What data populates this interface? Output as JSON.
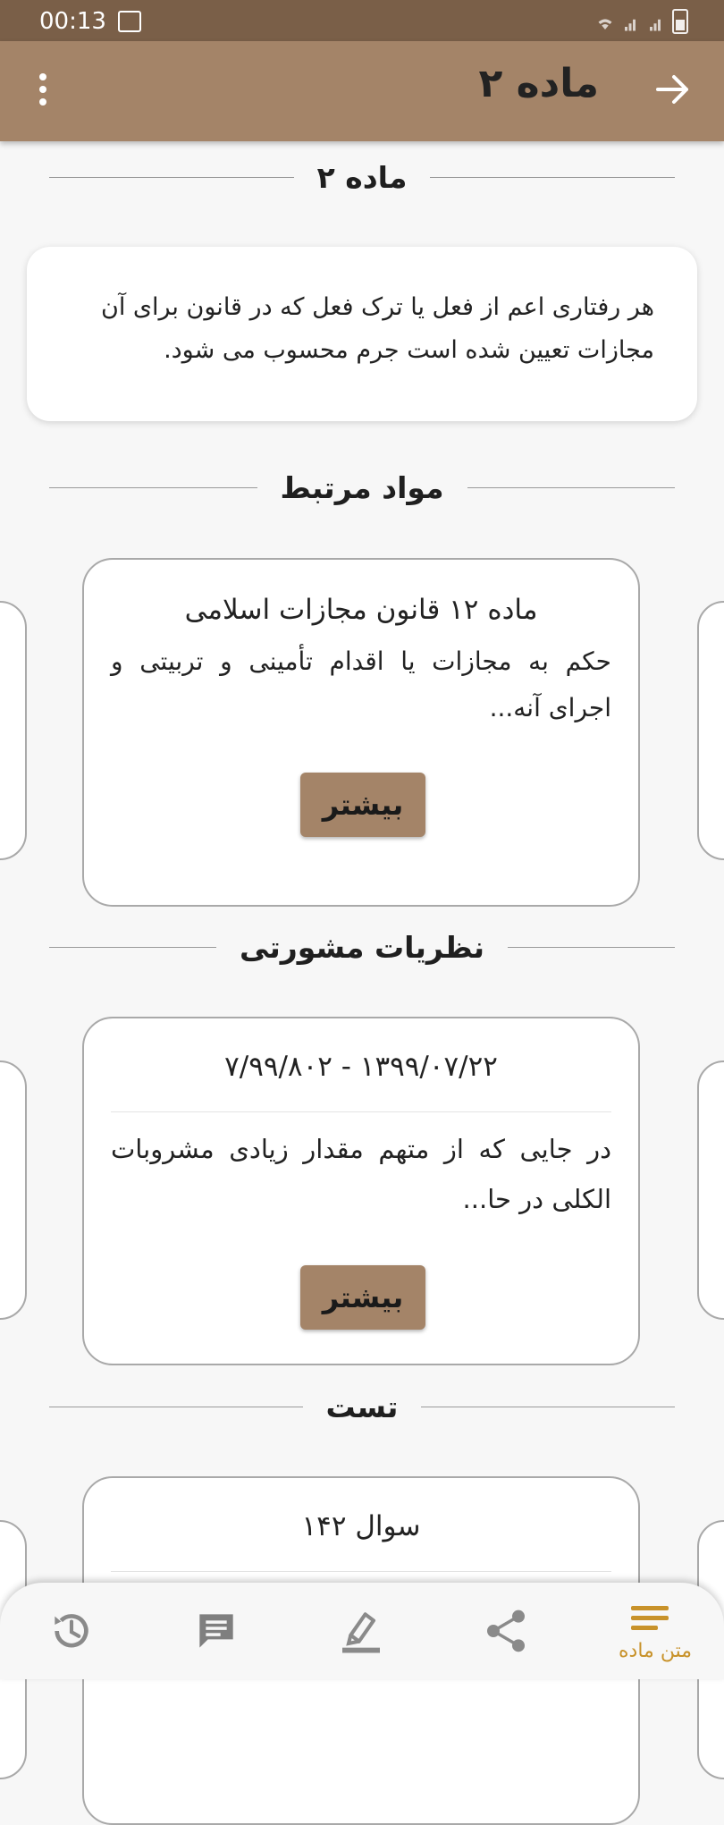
{
  "status": {
    "time": "00:13"
  },
  "app_bar": {
    "title": "ماده ۲"
  },
  "section_article": {
    "label": "ماده ۲"
  },
  "article": {
    "text": "هر رفتاری اعم از فعل یا ترک فعل که در قانون برای آن مجازات تعیین شده است جرم محسوب می شود."
  },
  "section_related": {
    "label": "مواد مرتبط"
  },
  "related": {
    "title": "ماده ۱۲ قانون مجازات اسلامی",
    "body": "حکم به مجازات یا اقدام تأمینی و تربیتی و اجرای آنه...",
    "more_label": "بیشتر"
  },
  "section_opinions": {
    "label": "نظریات مشورتی"
  },
  "opinion": {
    "title": "۱۳۹۹/۰۷/۲۲ - ۷/۹۹/۸۰۲",
    "body": "در جایی که از متهم مقدار زیادی مشروبات الکلی در حا...",
    "more_label": "بیشتر"
  },
  "section_test": {
    "label": "تست"
  },
  "test": {
    "title": "سوال ۱۴۲"
  },
  "bottom_nav": {
    "active_label": "متن ماده",
    "items": [
      "history-icon",
      "comment-icon",
      "highlight-icon",
      "share-icon",
      "article-text-icon"
    ]
  },
  "colors": {
    "primary": "#a48468",
    "status_bar": "#7a5f48",
    "accent": "#c8922a"
  }
}
